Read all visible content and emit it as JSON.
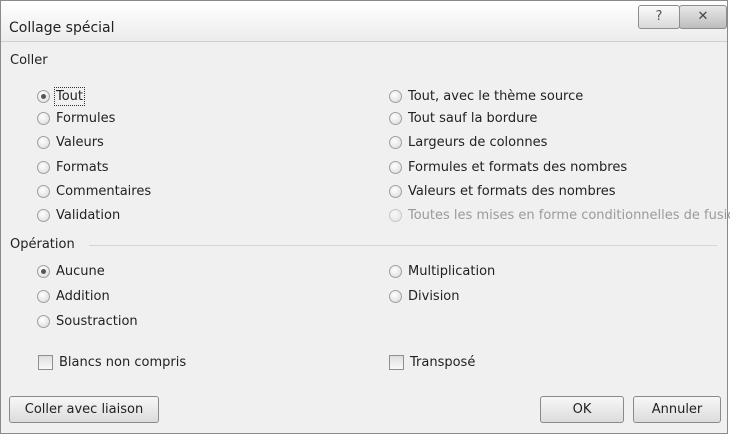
{
  "window": {
    "title": "Collage spécial",
    "help_glyph": "?",
    "close_glyph": "✕"
  },
  "coller": {
    "label": "Coller",
    "left": [
      {
        "label": "Tout",
        "checked": true
      },
      {
        "label": "Formules",
        "checked": false
      },
      {
        "label": "Valeurs",
        "checked": false
      },
      {
        "label": "Formats",
        "checked": false
      },
      {
        "label": "Commentaires",
        "checked": false
      },
      {
        "label": "Validation",
        "checked": false
      }
    ],
    "right": [
      {
        "label": "Tout, avec le thème source",
        "enabled": true
      },
      {
        "label": "Tout sauf la bordure",
        "enabled": true
      },
      {
        "label": "Largeurs de colonnes",
        "enabled": true
      },
      {
        "label": "Formules et formats des nombres",
        "enabled": true
      },
      {
        "label": "Valeurs et formats des nombres",
        "enabled": true
      },
      {
        "label": "Toutes les mises en forme conditionnelles de fusion",
        "enabled": false
      }
    ]
  },
  "operation": {
    "label": "Opération",
    "left": [
      {
        "label": "Aucune",
        "checked": true
      },
      {
        "label": "Addition",
        "checked": false
      },
      {
        "label": "Soustraction",
        "checked": false
      }
    ],
    "right": [
      {
        "label": "Multiplication"
      },
      {
        "label": "Division"
      }
    ]
  },
  "checkboxes": {
    "blancs": {
      "label": "Blancs non compris",
      "checked": false
    },
    "transpose": {
      "label": "Transposé",
      "checked": false
    }
  },
  "buttons": {
    "link": "Coller avec liaison",
    "ok": "OK",
    "cancel": "Annuler"
  }
}
